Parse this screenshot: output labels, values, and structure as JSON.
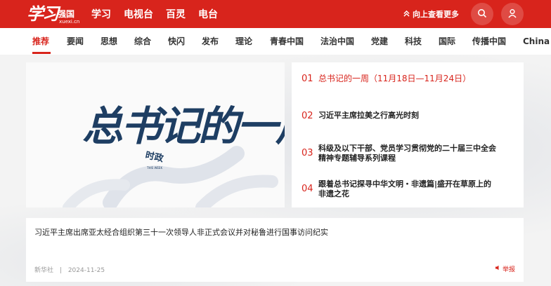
{
  "header": {
    "logo_brush": "学习",
    "logo_cn": "强国",
    "logo_url": "xuexi.cn",
    "nav": [
      "学习",
      "电视台",
      "百灵",
      "电台"
    ],
    "uplink_label": "向上查看更多",
    "colors": {
      "brand": "#d8241c",
      "nav_text": "#ffffff"
    }
  },
  "subnav": [
    "推荐",
    "要闻",
    "思想",
    "综合",
    "快闪",
    "发布",
    "理论",
    "青春中国",
    "法治中国",
    "党建",
    "科技",
    "国际",
    "传播中国",
    "China"
  ],
  "banner": {
    "title": "总书记的一周",
    "badge_title": "时政",
    "badge_sub": "THIS WEEK"
  },
  "list": [
    {
      "num": "01",
      "text": "总书记的一周（11月18日—11月24日）",
      "active": true
    },
    {
      "num": "02",
      "text": "习近平主席拉美之行高光时刻"
    },
    {
      "num": "03",
      "text_line1": "科级及以下干部、党员学习贯彻党的二十届三中全会",
      "text_line2": "精神专题辅导系列课程"
    },
    {
      "num": "04",
      "text_line1": "跟着总书记探寻中华文明・非遗篇|盛开在草原上的",
      "text_line2": "非遗之花"
    }
  ],
  "article": {
    "title": "习近平主席出席亚太经合组织第三十一次领导人非正式会议并对秘鲁进行国事访问纪实",
    "source": "新华社",
    "separator": "|",
    "date": "2024-11-25",
    "report_label": "举报"
  },
  "icons": [
    "search-icon",
    "user-icon",
    "chevron-up-icon",
    "report-icon"
  ]
}
